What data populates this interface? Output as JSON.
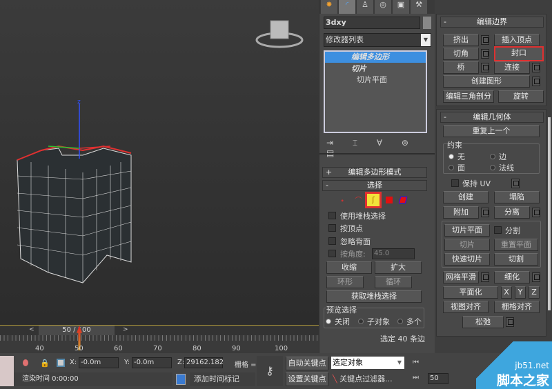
{
  "viewport": {
    "navcube": "navcube"
  },
  "cmd_tabs": [
    "create",
    "modify",
    "hierarchy",
    "motion",
    "display",
    "utilities"
  ],
  "object_name": "3dxy",
  "modifier_list": "修改器列表",
  "stack": [
    {
      "label": "编辑多边形",
      "selected": true
    },
    {
      "label": "切片"
    },
    {
      "label": "切片平面",
      "sub": true
    }
  ],
  "rollouts": {
    "edit_poly_mode": {
      "title": "编辑多边形模式",
      "toggle": "+"
    },
    "selection": {
      "title": "选择",
      "toggle": "-",
      "use_stack": "使用堆栈选择",
      "by_vertex": "按顶点",
      "ignore_backface": "忽略背面",
      "by_angle": "按角度:",
      "angle_value": "45.0",
      "shrink": "收缩",
      "grow": "扩大",
      "ring": "环形",
      "loop": "循环",
      "get_stack": "获取堆栈选择",
      "preview": "预览选择",
      "preview_opts": [
        "关闭",
        "子对象",
        "多个"
      ],
      "status": "选定 40 条边"
    },
    "edit_borders": {
      "title": "编辑边界",
      "toggle": "-",
      "buttons": [
        "挤出",
        "插入顶点",
        "切角",
        "封口",
        "桥",
        "连接",
        "创建图形",
        "编辑三角剖分",
        "旋转"
      ]
    },
    "edit_geometry": {
      "title": "编辑几何体",
      "toggle": "-",
      "repeat": "重复上一个",
      "constraints": "约束",
      "c_opts": [
        "无",
        "边",
        "面",
        "法线"
      ],
      "preserve_uv": "保持 UV",
      "create": "创建",
      "collapse": "塌陷",
      "attach": "附加",
      "detach": "分离",
      "slice_plane": "切片平面",
      "split": "分割",
      "slice": "切片",
      "reset_plane": "重置平面",
      "quickslice": "快速切片",
      "cut": "切割",
      "meshsmooth": "网格平滑",
      "tessellate": "细化",
      "planar": "平面化",
      "x": "X",
      "y": "Y",
      "z": "Z",
      "view_align": "视图对齐",
      "grid_align": "栅格对齐",
      "relax": "松弛"
    }
  },
  "timeline": {
    "frame": "50 / 100",
    "prev": "<",
    "next": ">",
    "ticks": [
      "40",
      "50",
      "60",
      "70",
      "80",
      "90",
      "100"
    ],
    "current": 50,
    "total": 100
  },
  "status": {
    "x_label": "X:",
    "x": "-0.0m",
    "y_label": "Y:",
    "y": "-0.0m",
    "z_label": "Z:",
    "z": "29162.182",
    "grid": "栅格 =",
    "render_time": "渲染时间  0:00:00",
    "add_time_tag": "添加时间标记",
    "auto_key": "自动关键点",
    "set_key": "设置关键点",
    "key_mode": "选定对象",
    "key_filters": "关键点过滤器...",
    "frame_field": "50"
  },
  "watermark": {
    "site": "jb51.net",
    "name": "脚本之家"
  },
  "colors": {
    "highlight": "#e03030",
    "selected": "#3d8fe0",
    "accent": "#f2e23a"
  }
}
